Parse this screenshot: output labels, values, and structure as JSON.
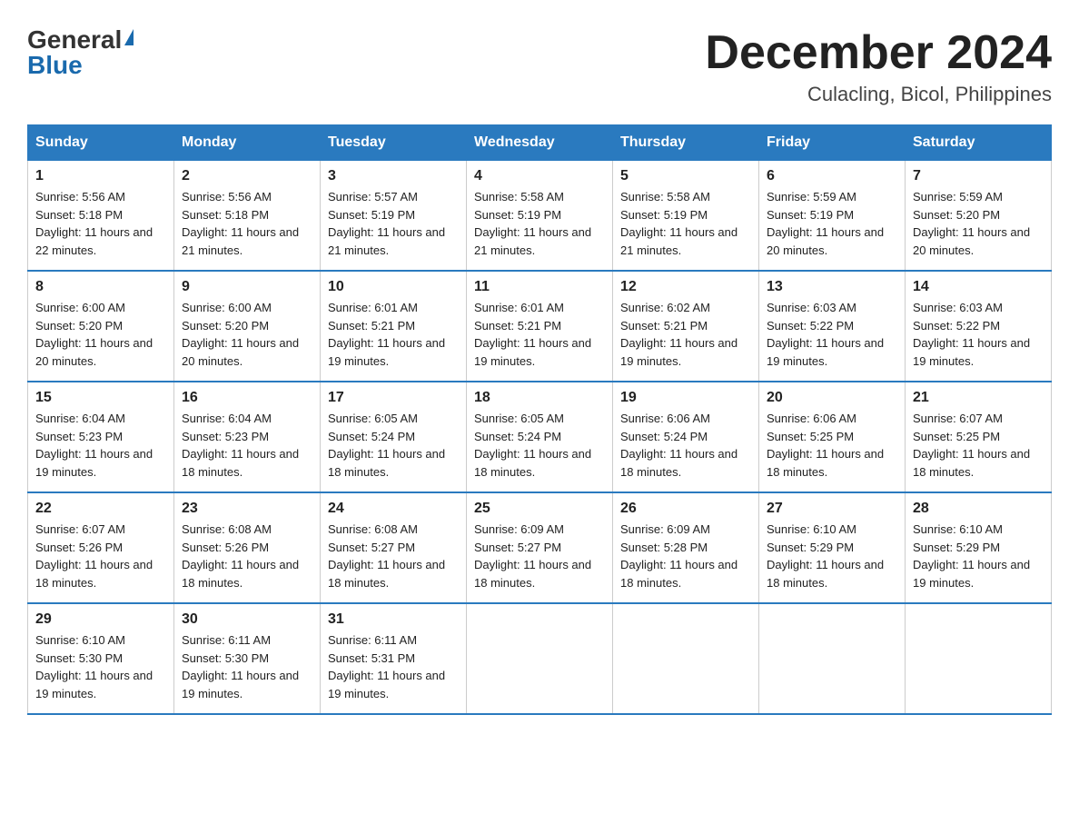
{
  "header": {
    "logo_general": "General",
    "logo_blue": "Blue",
    "month_title": "December 2024",
    "location": "Culacling, Bicol, Philippines"
  },
  "days_of_week": [
    "Sunday",
    "Monday",
    "Tuesday",
    "Wednesday",
    "Thursday",
    "Friday",
    "Saturday"
  ],
  "weeks": [
    [
      {
        "day": "1",
        "sunrise": "5:56 AM",
        "sunset": "5:18 PM",
        "daylight": "11 hours and 22 minutes."
      },
      {
        "day": "2",
        "sunrise": "5:56 AM",
        "sunset": "5:18 PM",
        "daylight": "11 hours and 21 minutes."
      },
      {
        "day": "3",
        "sunrise": "5:57 AM",
        "sunset": "5:19 PM",
        "daylight": "11 hours and 21 minutes."
      },
      {
        "day": "4",
        "sunrise": "5:58 AM",
        "sunset": "5:19 PM",
        "daylight": "11 hours and 21 minutes."
      },
      {
        "day": "5",
        "sunrise": "5:58 AM",
        "sunset": "5:19 PM",
        "daylight": "11 hours and 21 minutes."
      },
      {
        "day": "6",
        "sunrise": "5:59 AM",
        "sunset": "5:19 PM",
        "daylight": "11 hours and 20 minutes."
      },
      {
        "day": "7",
        "sunrise": "5:59 AM",
        "sunset": "5:20 PM",
        "daylight": "11 hours and 20 minutes."
      }
    ],
    [
      {
        "day": "8",
        "sunrise": "6:00 AM",
        "sunset": "5:20 PM",
        "daylight": "11 hours and 20 minutes."
      },
      {
        "day": "9",
        "sunrise": "6:00 AM",
        "sunset": "5:20 PM",
        "daylight": "11 hours and 20 minutes."
      },
      {
        "day": "10",
        "sunrise": "6:01 AM",
        "sunset": "5:21 PM",
        "daylight": "11 hours and 19 minutes."
      },
      {
        "day": "11",
        "sunrise": "6:01 AM",
        "sunset": "5:21 PM",
        "daylight": "11 hours and 19 minutes."
      },
      {
        "day": "12",
        "sunrise": "6:02 AM",
        "sunset": "5:21 PM",
        "daylight": "11 hours and 19 minutes."
      },
      {
        "day": "13",
        "sunrise": "6:03 AM",
        "sunset": "5:22 PM",
        "daylight": "11 hours and 19 minutes."
      },
      {
        "day": "14",
        "sunrise": "6:03 AM",
        "sunset": "5:22 PM",
        "daylight": "11 hours and 19 minutes."
      }
    ],
    [
      {
        "day": "15",
        "sunrise": "6:04 AM",
        "sunset": "5:23 PM",
        "daylight": "11 hours and 19 minutes."
      },
      {
        "day": "16",
        "sunrise": "6:04 AM",
        "sunset": "5:23 PM",
        "daylight": "11 hours and 18 minutes."
      },
      {
        "day": "17",
        "sunrise": "6:05 AM",
        "sunset": "5:24 PM",
        "daylight": "11 hours and 18 minutes."
      },
      {
        "day": "18",
        "sunrise": "6:05 AM",
        "sunset": "5:24 PM",
        "daylight": "11 hours and 18 minutes."
      },
      {
        "day": "19",
        "sunrise": "6:06 AM",
        "sunset": "5:24 PM",
        "daylight": "11 hours and 18 minutes."
      },
      {
        "day": "20",
        "sunrise": "6:06 AM",
        "sunset": "5:25 PM",
        "daylight": "11 hours and 18 minutes."
      },
      {
        "day": "21",
        "sunrise": "6:07 AM",
        "sunset": "5:25 PM",
        "daylight": "11 hours and 18 minutes."
      }
    ],
    [
      {
        "day": "22",
        "sunrise": "6:07 AM",
        "sunset": "5:26 PM",
        "daylight": "11 hours and 18 minutes."
      },
      {
        "day": "23",
        "sunrise": "6:08 AM",
        "sunset": "5:26 PM",
        "daylight": "11 hours and 18 minutes."
      },
      {
        "day": "24",
        "sunrise": "6:08 AM",
        "sunset": "5:27 PM",
        "daylight": "11 hours and 18 minutes."
      },
      {
        "day": "25",
        "sunrise": "6:09 AM",
        "sunset": "5:27 PM",
        "daylight": "11 hours and 18 minutes."
      },
      {
        "day": "26",
        "sunrise": "6:09 AM",
        "sunset": "5:28 PM",
        "daylight": "11 hours and 18 minutes."
      },
      {
        "day": "27",
        "sunrise": "6:10 AM",
        "sunset": "5:29 PM",
        "daylight": "11 hours and 18 minutes."
      },
      {
        "day": "28",
        "sunrise": "6:10 AM",
        "sunset": "5:29 PM",
        "daylight": "11 hours and 19 minutes."
      }
    ],
    [
      {
        "day": "29",
        "sunrise": "6:10 AM",
        "sunset": "5:30 PM",
        "daylight": "11 hours and 19 minutes."
      },
      {
        "day": "30",
        "sunrise": "6:11 AM",
        "sunset": "5:30 PM",
        "daylight": "11 hours and 19 minutes."
      },
      {
        "day": "31",
        "sunrise": "6:11 AM",
        "sunset": "5:31 PM",
        "daylight": "11 hours and 19 minutes."
      },
      null,
      null,
      null,
      null
    ]
  ]
}
